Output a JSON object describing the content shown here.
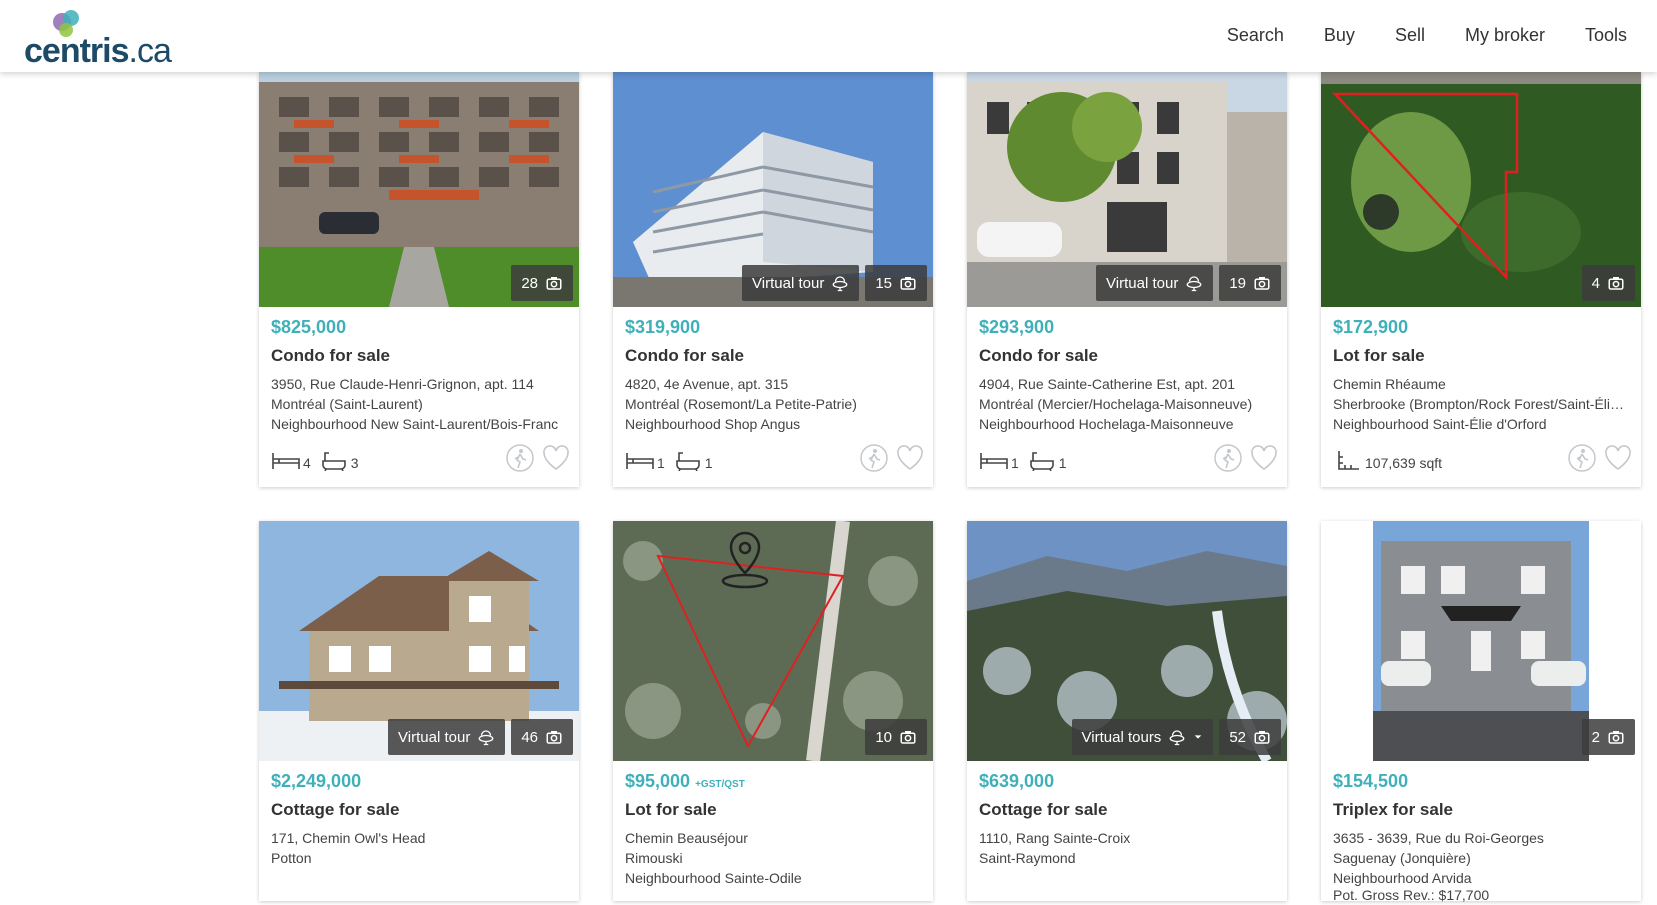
{
  "header": {
    "logo_text": "centris",
    "logo_suffix": ".ca",
    "nav": [
      "Search",
      "Buy",
      "Sell",
      "My broker",
      "Tools"
    ]
  },
  "listings": [
    {
      "price": "$825,000",
      "price_note": "",
      "category": "Condo for sale",
      "address_lines": [
        "3950, Rue Claude-Henri-Grignon, apt. 114",
        "Montréal (Saint-Laurent)",
        "Neighbourhood New Saint-Laurent/Bois-Franc"
      ],
      "photo_count": "28",
      "virtual_tour": "",
      "bedrooms": "4",
      "bathrooms": "3",
      "lot_area": ""
    },
    {
      "price": "$319,900",
      "price_note": "",
      "category": "Condo for sale",
      "address_lines": [
        "4820, 4e Avenue, apt. 315",
        "Montréal (Rosemont/La Petite-Patrie)",
        "Neighbourhood Shop Angus"
      ],
      "photo_count": "15",
      "virtual_tour": "Virtual tour",
      "bedrooms": "1",
      "bathrooms": "1",
      "lot_area": ""
    },
    {
      "price": "$293,900",
      "price_note": "",
      "category": "Condo for sale",
      "address_lines": [
        "4904, Rue Sainte-Catherine Est, apt. 201",
        "Montréal (Mercier/Hochelaga-Maisonneuve)",
        "Neighbourhood Hochelaga-Maisonneuve"
      ],
      "photo_count": "19",
      "virtual_tour": "Virtual tour",
      "bedrooms": "1",
      "bathrooms": "1",
      "lot_area": ""
    },
    {
      "price": "$172,900",
      "price_note": "",
      "category": "Lot for sale",
      "address_lines": [
        "Chemin Rhéaume",
        "Sherbrooke (Brompton/Rock Forest/Saint-Élie/Deauville)",
        "Neighbourhood Saint-Élie d'Orford"
      ],
      "photo_count": "4",
      "virtual_tour": "",
      "bedrooms": "",
      "bathrooms": "",
      "lot_area": "107,639 sqft"
    },
    {
      "price": "$2,249,000",
      "price_note": "",
      "category": "Cottage for sale",
      "address_lines": [
        "171, Chemin Owl's Head",
        "Potton"
      ],
      "photo_count": "46",
      "virtual_tour": "Virtual tour",
      "bedrooms": "",
      "bathrooms": "",
      "lot_area": ""
    },
    {
      "price": "$95,000",
      "price_note": "+GST/QST",
      "category": "Lot for sale",
      "address_lines": [
        "Chemin Beauséjour",
        "Rimouski",
        "Neighbourhood Sainte-Odile"
      ],
      "photo_count": "10",
      "virtual_tour": "",
      "bedrooms": "",
      "bathrooms": "",
      "lot_area": ""
    },
    {
      "price": "$639,000",
      "price_note": "",
      "category": "Cottage for sale",
      "address_lines": [
        "1110, Rang Sainte-Croix",
        "Saint-Raymond"
      ],
      "photo_count": "52",
      "virtual_tour": "Virtual tours",
      "bedrooms": "",
      "bathrooms": "",
      "lot_area": ""
    },
    {
      "price": "$154,500",
      "price_note": "",
      "category": "Triplex for sale",
      "address_lines": [
        "3635 - 3639, Rue du Roi-Georges",
        "Saguenay (Jonquière)",
        "Neighbourhood Arvida",
        "Pot. Gross Rev.: $17,700"
      ],
      "photo_count": "2",
      "virtual_tour": "",
      "bedrooms": "",
      "bathrooms": "",
      "lot_area": ""
    }
  ],
  "colors": {
    "price": "#3fb0ba",
    "logo": "#1d4a66",
    "badge_bg": "#3c3c3c"
  },
  "icons": {
    "photo": "camera-icon",
    "tour": "virtual-tour-icon",
    "bed": "bed-icon",
    "bath": "bath-icon",
    "lot": "lot-area-icon",
    "walkscore": "walk-icon",
    "favorite": "heart-icon"
  }
}
